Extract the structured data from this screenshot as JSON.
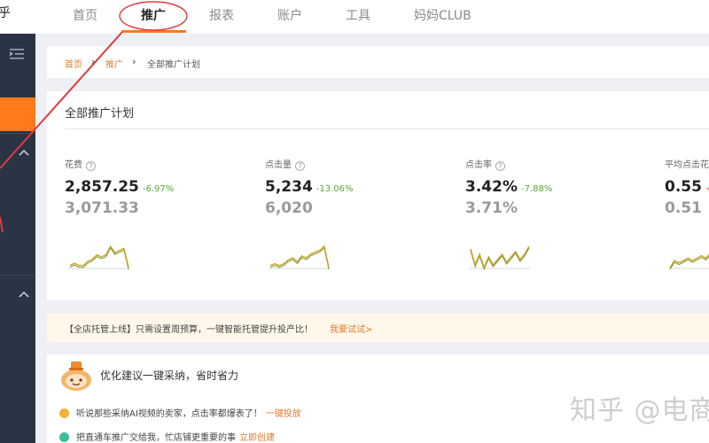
{
  "header": {
    "brand_fragment": "乎",
    "nav": [
      {
        "label": "首页",
        "active": false
      },
      {
        "label": "推广",
        "active": true
      },
      {
        "label": "报表",
        "active": false
      },
      {
        "label": "账户",
        "active": false
      },
      {
        "label": "工具",
        "active": false
      },
      {
        "label": "妈妈CLUB",
        "active": false
      }
    ]
  },
  "colors": {
    "accent": "#ff7a1a",
    "sidebar": "#2b3445",
    "link": "#e07a2e",
    "annotation": "#e03a3a",
    "spark_line": "#c9a227",
    "spark_alt": "#7a9a3a"
  },
  "breadcrumb": {
    "items": [
      "首页",
      "推广",
      "全部推广计划"
    ]
  },
  "stats": {
    "title": "全部推广计划",
    "metrics": [
      {
        "label": "花费",
        "value": "2,857.25",
        "change": "-6.97%",
        "prev": "3,071.33",
        "trend": [
          4,
          5,
          4,
          4,
          6,
          7,
          9,
          8,
          9,
          13,
          10,
          11,
          12,
          3
        ]
      },
      {
        "label": "点击量",
        "value": "5,234",
        "change": "-13.06%",
        "prev": "6,020",
        "trend": [
          4,
          5,
          4,
          5,
          7,
          8,
          6,
          9,
          8,
          10,
          11,
          12,
          14,
          3
        ]
      },
      {
        "label": "点击率",
        "value": "3.42%",
        "change": "-7.88%",
        "prev": "3.71%",
        "trend": [
          12,
          6,
          10,
          5,
          9,
          6,
          8,
          10,
          7,
          9,
          11,
          8,
          10,
          13
        ]
      },
      {
        "label": "平均点击花",
        "value": "0.55",
        "change": "+",
        "prev": "0.51",
        "trend": [
          3,
          6,
          5,
          6,
          7,
          6,
          7,
          8,
          7,
          9,
          8,
          10,
          9,
          12
        ]
      }
    ]
  },
  "notice": {
    "text": "【全店托管上线】只需设置周预算，一键智能托管提升投产比！",
    "link": "我要试试>"
  },
  "optimization": {
    "title": "优化建议一键采纳，省时省力",
    "rows": [
      {
        "text": "听说那些采纳AI视频的卖家，点击率都爆表了！",
        "link": "一键投放",
        "dot_color": "#f2b23a"
      },
      {
        "text": "把直通车推广交给我，忙店铺更重要的事",
        "link": "立即创建",
        "dot_color": "#3abf9a"
      }
    ]
  },
  "watermark": "知乎 @电商"
}
